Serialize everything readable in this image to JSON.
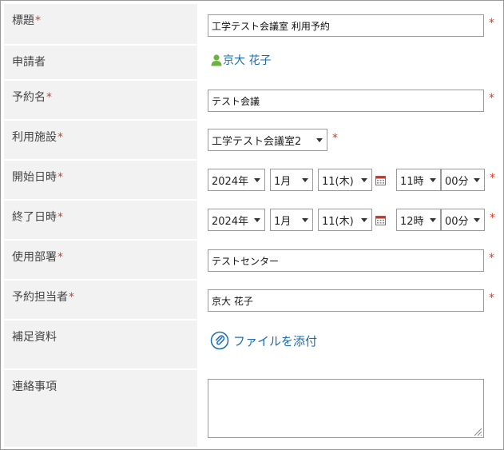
{
  "required_mark": "*",
  "colors": {
    "label_bg": "#f2f2f2",
    "required": "#d93b2b",
    "link": "#1a6bb5",
    "border": "#9a9a9a"
  },
  "title": {
    "label": "標題",
    "value": "工学テスト会議室 利用予約"
  },
  "applicant": {
    "label": "申請者",
    "name": "京大 花子",
    "icon": "user-icon"
  },
  "reservation_name": {
    "label": "予約名",
    "value": "テスト会議"
  },
  "facility": {
    "label": "利用施設",
    "selected": "工学テスト会議室2"
  },
  "start": {
    "label": "開始日時",
    "year": "2024年",
    "month": "1月",
    "day": "11(木)",
    "hour": "11時",
    "minute": "00分",
    "icon": "calendar-icon"
  },
  "end": {
    "label": "終了日時",
    "year": "2024年",
    "month": "1月",
    "day": "11(木)",
    "hour": "12時",
    "minute": "00分",
    "icon": "calendar-icon"
  },
  "department": {
    "label": "使用部署",
    "value": "テストセンター"
  },
  "person_in_charge": {
    "label": "予約担当者",
    "value": "京大 花子"
  },
  "attachments": {
    "label": "補足資料",
    "link": "ファイルを添付",
    "icon": "paperclip-icon"
  },
  "notes": {
    "label": "連絡事項",
    "value": ""
  }
}
